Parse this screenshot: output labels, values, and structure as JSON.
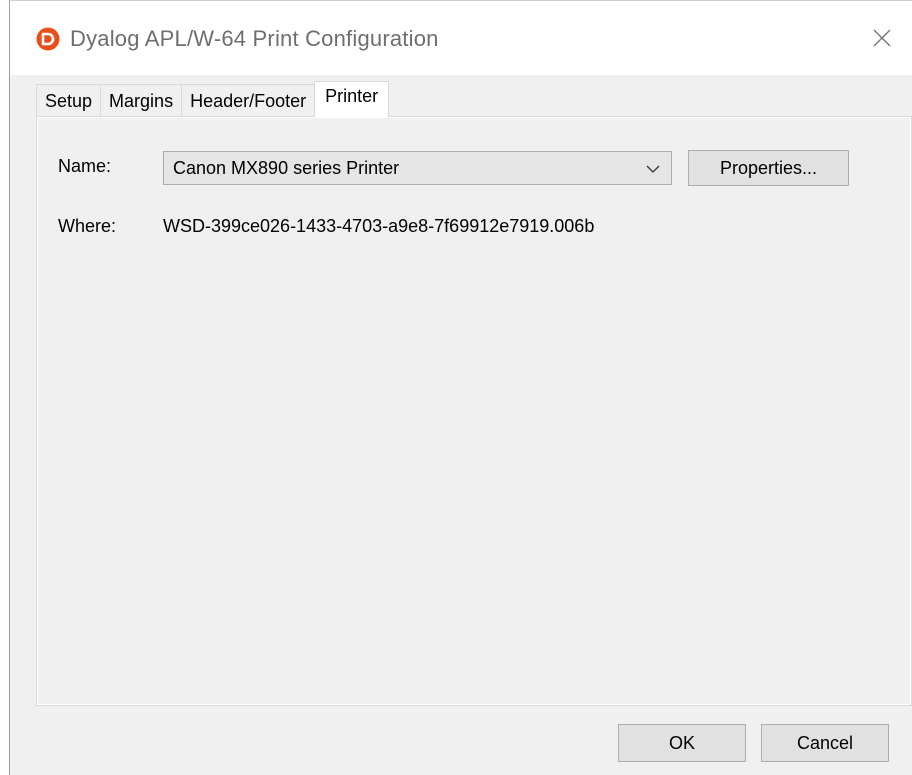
{
  "window": {
    "title": "Dyalog APL/W-64 Print Configuration",
    "icon": "dyalog-app-icon",
    "close_icon": "close-icon",
    "accent_color": "#e8501b"
  },
  "tabs": [
    {
      "label": "Setup",
      "active": false
    },
    {
      "label": "Margins",
      "active": false
    },
    {
      "label": "Header/Footer",
      "active": false
    },
    {
      "label": "Printer",
      "active": true
    }
  ],
  "printer": {
    "name_label": "Name:",
    "name_value": "Canon MX890 series Printer",
    "properties_label": "Properties...",
    "where_label": "Where:",
    "where_value": "WSD-399ce026-1433-4703-a9e8-7f69912e7919.006b"
  },
  "footer": {
    "ok_label": "OK",
    "cancel_label": "Cancel"
  }
}
